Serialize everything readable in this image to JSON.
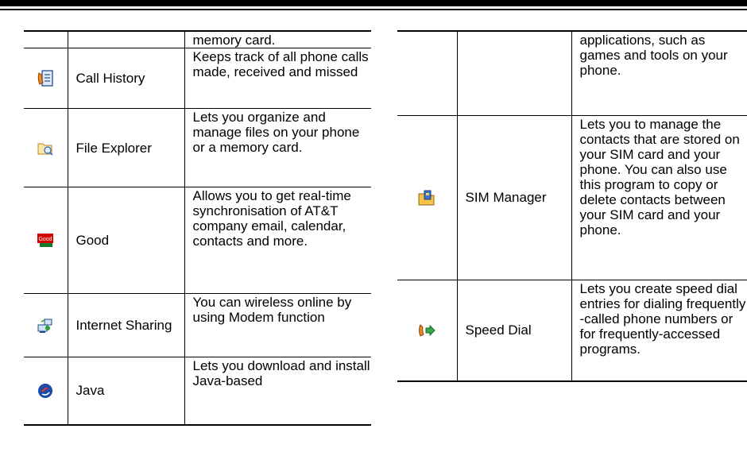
{
  "left_rows": [
    {
      "name": "",
      "desc": "memory card.",
      "icon": "none"
    },
    {
      "name": "Call History",
      "desc": "Keeps track of all phone calls made, received and missed",
      "icon": "call-history-icon"
    },
    {
      "name": "File Explorer",
      "desc": "Lets you organize and manage files on your phone or a memory card.",
      "icon": "file-explorer-icon"
    },
    {
      "name": "Good",
      "desc": "Allows you to get real-time synchronisation of AT&T company email, calendar, contacts and more.",
      "icon": "good-icon"
    },
    {
      "name": "Internet Sharing",
      "desc": "You can wireless online by using Modem function",
      "icon": "internet-sharing-icon"
    },
    {
      "name": "Java",
      "desc": "Lets you download and install Java-based",
      "icon": "java-icon"
    }
  ],
  "right_rows": [
    {
      "name": "",
      "desc": "applications, such as games and tools on your phone.",
      "icon": "none"
    },
    {
      "name": "SIM Manager",
      "desc": "Lets you to manage the contacts that are stored on your SIM card and your phone. You can also use this program to copy or delete contacts between your SIM card and your phone.",
      "icon": "sim-manager-icon"
    },
    {
      "name": "Speed Dial",
      "desc": "Lets you create speed dial entries for dialing frequently -called phone numbers or for frequently-accessed programs.",
      "icon": "speed-dial-icon"
    }
  ],
  "icon_labels": {
    "good": "Good"
  }
}
